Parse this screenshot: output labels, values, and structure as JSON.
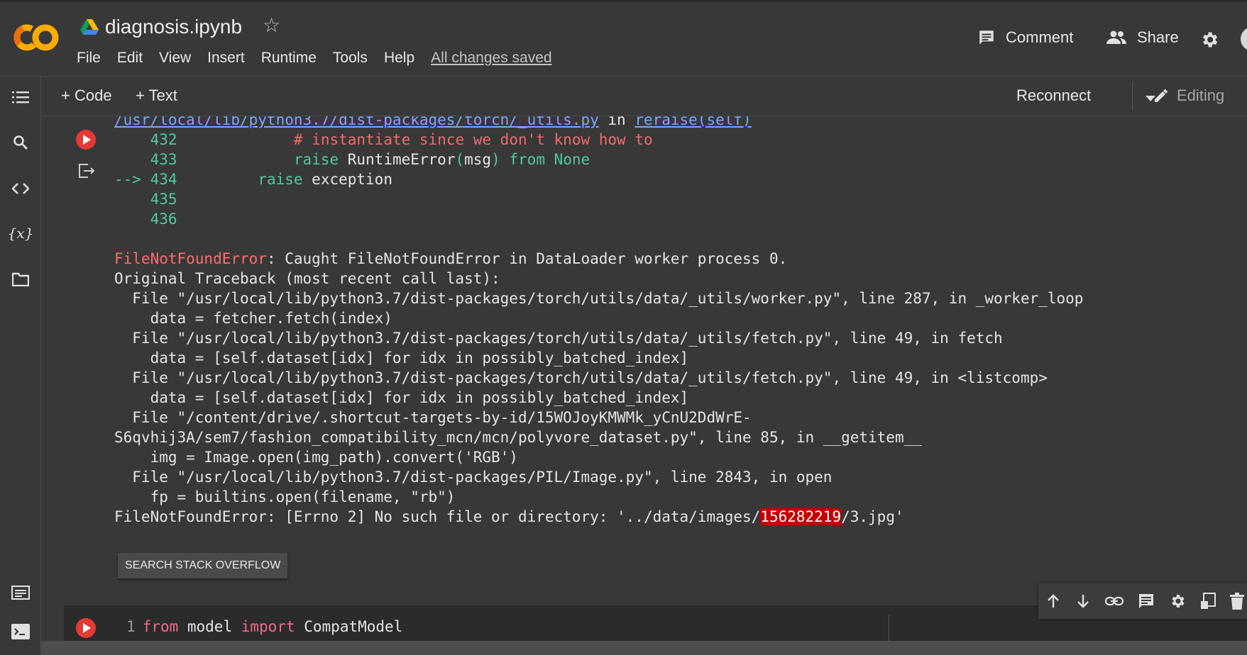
{
  "header": {
    "notebook_title": "diagnosis.ipynb",
    "menu": [
      "File",
      "Edit",
      "View",
      "Insert",
      "Runtime",
      "Tools",
      "Help"
    ],
    "save_status": "All changes saved",
    "comment_label": "Comment",
    "share_label": "Share",
    "icons": [
      "colab-logo-icon",
      "drive-icon",
      "star-icon",
      "comment-icon",
      "share-people-icon",
      "gear-icon",
      "avatar"
    ]
  },
  "left_rail": {
    "icons": [
      "table-of-contents-icon",
      "search-icon",
      "code-snippets-icon",
      "variables-icon",
      "folder-icon",
      "command-palette-icon",
      "terminal-icon"
    ],
    "variables_glyph": "{x}"
  },
  "toolbar": {
    "add_code": "+ Code",
    "add_text": "+ Text",
    "reconnect": "Reconnect",
    "editing": "Editing"
  },
  "output": {
    "lines": [
      {
        "parts": [
          {
            "t": "/usr/local/lib/python3.7/dist-packages/torch/_utils.py",
            "c": "link"
          },
          {
            "t": " in "
          },
          {
            "t": "reraise(self)",
            "c": "link2"
          }
        ]
      },
      {
        "parts": [
          {
            "t": "    432",
            "c": "green"
          },
          {
            "t": "             "
          },
          {
            "t": "# instantiate since we don't know how to",
            "c": "red"
          }
        ]
      },
      {
        "parts": [
          {
            "t": "    433",
            "c": "green"
          },
          {
            "t": "             "
          },
          {
            "t": "raise",
            "c": "green"
          },
          {
            "t": " RuntimeError"
          },
          {
            "t": "(",
            "c": "green"
          },
          {
            "t": "msg"
          },
          {
            "t": ")",
            "c": "green"
          },
          {
            "t": " "
          },
          {
            "t": "from",
            "c": "green"
          },
          {
            "t": " "
          },
          {
            "t": "None",
            "c": "green"
          }
        ]
      },
      {
        "parts": [
          {
            "t": "--> 434",
            "c": "green"
          },
          {
            "t": "         "
          },
          {
            "t": "raise",
            "c": "green"
          },
          {
            "t": " exception"
          }
        ]
      },
      {
        "parts": [
          {
            "t": "    435",
            "c": "green"
          }
        ]
      },
      {
        "parts": [
          {
            "t": "    436",
            "c": "green"
          }
        ]
      },
      {
        "parts": [
          {
            "t": ""
          }
        ]
      },
      {
        "parts": [
          {
            "t": "FileNotFoundError",
            "c": "err"
          },
          {
            "t": ": Caught FileNotFoundError in DataLoader worker process 0."
          }
        ]
      },
      {
        "parts": [
          {
            "t": "Original Traceback (most recent call last):"
          }
        ]
      },
      {
        "parts": [
          {
            "t": "  File \"/usr/local/lib/python3.7/dist-packages/torch/utils/data/_utils/worker.py\", line 287, in _worker_loop"
          }
        ]
      },
      {
        "parts": [
          {
            "t": "    data = fetcher.fetch(index)"
          }
        ]
      },
      {
        "parts": [
          {
            "t": "  File \"/usr/local/lib/python3.7/dist-packages/torch/utils/data/_utils/fetch.py\", line 49, in fetch"
          }
        ]
      },
      {
        "parts": [
          {
            "t": "    data = [self.dataset[idx] for idx in possibly_batched_index]"
          }
        ]
      },
      {
        "parts": [
          {
            "t": "  File \"/usr/local/lib/python3.7/dist-packages/torch/utils/data/_utils/fetch.py\", line 49, in <listcomp>"
          }
        ]
      },
      {
        "parts": [
          {
            "t": "    data = [self.dataset[idx] for idx in possibly_batched_index]"
          }
        ]
      },
      {
        "parts": [
          {
            "t": "  File \"/content/drive/.shortcut-targets-by-id/15WOJoyKMWMk_yCnU2DdWrE-"
          }
        ]
      },
      {
        "parts": [
          {
            "t": "S6qvhij3A/sem7/fashion_compatibility_mcn/mcn/polyvore_dataset.py\", line 85, in __getitem__"
          }
        ]
      },
      {
        "parts": [
          {
            "t": "    img = Image.open(img_path).convert('RGB')"
          }
        ]
      },
      {
        "parts": [
          {
            "t": "  File \"/usr/local/lib/python3.7/dist-packages/PIL/Image.py\", line 2843, in open"
          }
        ]
      },
      {
        "parts": [
          {
            "t": "    fp = builtins.open(filename, \"rb\")"
          }
        ]
      },
      {
        "parts": [
          {
            "t": "FileNotFoundError: [Errno 2] No such file or directory: '../data/images/"
          },
          {
            "t": "156282219",
            "c": "hl"
          },
          {
            "t": "/3.jpg'"
          }
        ]
      }
    ],
    "search_button": "SEARCH STACK OVERFLOW"
  },
  "next_cell": {
    "line_number": "1",
    "code_parts": [
      {
        "t": "from",
        "c": "key"
      },
      {
        "t": " model "
      },
      {
        "t": "import",
        "c": "key"
      },
      {
        "t": " CompatModel"
      }
    ]
  },
  "cell_toolbar_icons": [
    "move-up-icon",
    "move-down-icon",
    "link-icon",
    "comment-icon",
    "cell-settings-icon",
    "mirror-cell-icon",
    "delete-icon"
  ],
  "colors": {
    "background": "#383838",
    "accent_orange": "#f9ab00",
    "run_red": "#e53935",
    "error_highlight": "#c50000",
    "line_number_green": "#4ec9a2",
    "link_blue": "#7aa7ff"
  }
}
